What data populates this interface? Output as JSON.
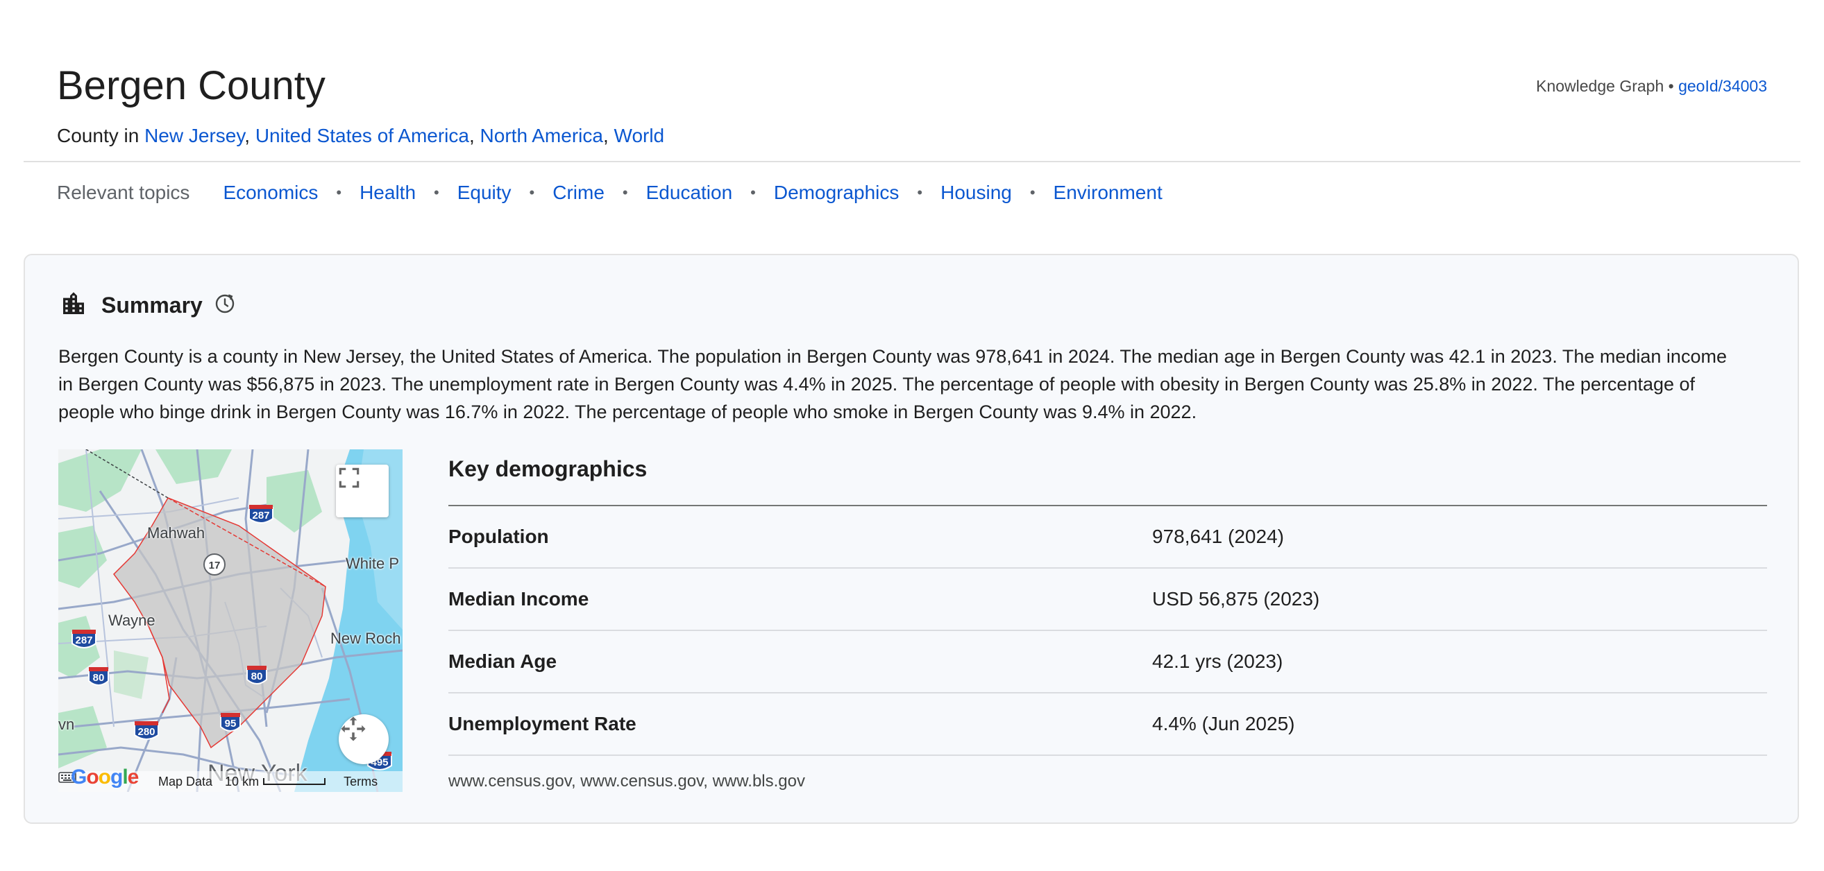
{
  "header": {
    "title": "Bergen County",
    "subtitle_prefix": "County in",
    "places": [
      "New Jersey",
      "United States of America",
      "North America",
      "World"
    ],
    "kg_label": "Knowledge Graph •",
    "kg_id": "geoId/34003"
  },
  "topics": {
    "label": "Relevant topics",
    "items": [
      "Economics",
      "Health",
      "Equity",
      "Crime",
      "Education",
      "Demographics",
      "Housing",
      "Environment"
    ]
  },
  "summary": {
    "title": "Summary",
    "text": "Bergen County is a county in New Jersey, the United States of America. The population in Bergen County was 978,641 in 2024. The median age in Bergen County was 42.1 in 2023. The median income in Bergen County was $56,875 in 2023. The unemployment rate in Bergen County was 4.4% in 2025. The percentage of people with obesity in Bergen County was 25.8% in 2022. The percentage of people who binge drink in Bergen County was 16.7% in 2022. The percentage of people who smoke in Bergen County was 9.4% in 2022."
  },
  "map": {
    "labels": {
      "mahwah": "Mahwah",
      "white_plains": "White P",
      "wayne": "Wayne",
      "new_rochelle": "New Roch",
      "town": "vn",
      "new_york": "New York"
    },
    "shields": {
      "i287_top": "287",
      "r17": "17",
      "i287_left": "287",
      "i80_left": "80",
      "i80_mid": "80",
      "i280": "280",
      "i95": "95",
      "i495": "495"
    },
    "footer": {
      "map_data": "Map Data",
      "scale": "10 km",
      "terms": "Terms"
    }
  },
  "key_demographics": {
    "title": "Key demographics",
    "rows": [
      {
        "label": "Population",
        "value": "978,641 (2024)"
      },
      {
        "label": "Median Income",
        "value": "USD 56,875 (2023)"
      },
      {
        "label": "Median Age",
        "value": "42.1 yrs (2023)"
      },
      {
        "label": "Unemployment Rate",
        "value": "4.4% (Jun 2025)"
      }
    ],
    "sources": "www.census.gov, www.census.gov, www.bls.gov"
  },
  "colors": {
    "link": "#0b57d0",
    "card_bg": "#f7f9fc",
    "county_fill": "#c4c4c4",
    "county_border": "#e53935",
    "water": "#7fd3f0",
    "park": "#b7e4c7"
  }
}
